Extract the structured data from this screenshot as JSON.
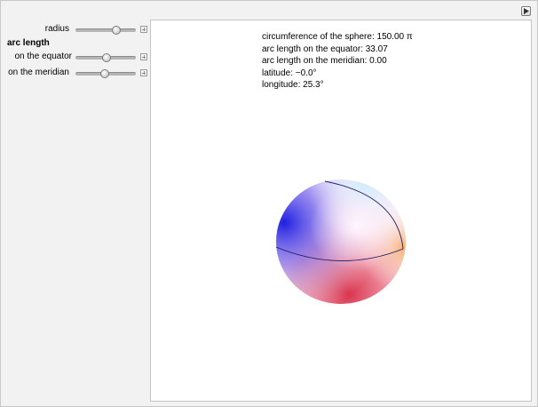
{
  "controls": {
    "radius": {
      "label": "radius",
      "value": 0.67
    },
    "arc_length_title": "arc length",
    "equator": {
      "label": "on the equator",
      "value": 0.52
    },
    "meridian": {
      "label": "on the meridian",
      "value": 0.49
    }
  },
  "readout": {
    "circumference": "circumference of the sphere: 150.00 π",
    "equator_arc": "arc length on the equator: 33.07",
    "meridian_arc": "arc length on the meridian: 0.00",
    "latitude": "latitude: −0.0°",
    "longitude": "longitude: 25.3°"
  },
  "icons": {
    "corner": "play-triangle-icon",
    "slider_expand": "plus-icon"
  },
  "colors": {
    "sphere_blue": "#3a3ae8",
    "sphere_red": "#e04050",
    "sphere_highlight": "#fff0f8",
    "curve": "#1a1a66"
  }
}
